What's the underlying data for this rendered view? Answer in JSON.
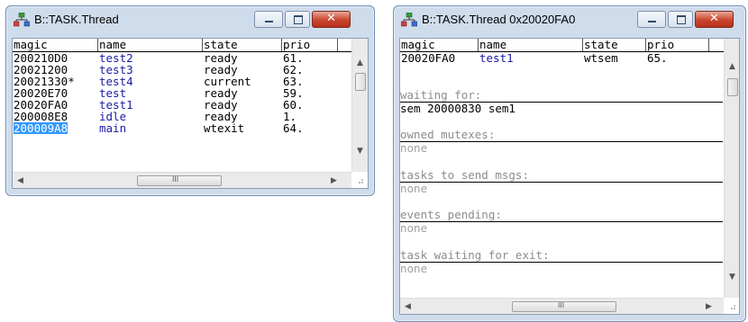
{
  "window1": {
    "title": "B::TASK.Thread",
    "columns": [
      "magic",
      "name",
      "state",
      "prio"
    ],
    "rows": [
      {
        "magic": "200210D0",
        "name": "test2",
        "state": "ready",
        "prio": "61."
      },
      {
        "magic": "20021200",
        "name": "test3",
        "state": "ready",
        "prio": "62."
      },
      {
        "magic": "20021330*",
        "name": "test4",
        "state": "current",
        "prio": "63."
      },
      {
        "magic": "20020E70",
        "name": "test",
        "state": "ready",
        "prio": "59."
      },
      {
        "magic": "20020FA0",
        "name": "test1",
        "state": "ready",
        "prio": "60."
      },
      {
        "magic": "200008E8",
        "name": "idle",
        "state": "ready",
        "prio": "1."
      },
      {
        "magic": "200009A8",
        "name": "main",
        "state": "wtexit",
        "prio": "64."
      }
    ],
    "selected_row": 6
  },
  "window2": {
    "title": "B::TASK.Thread 0x20020FA0",
    "columns": [
      "magic",
      "name",
      "state",
      "prio"
    ],
    "row": {
      "magic": "20020FA0",
      "name": "test1",
      "state": "wtsem",
      "prio": "65."
    },
    "sections": [
      {
        "title": "waiting for:",
        "value": "sem  20000830  sem1"
      },
      {
        "title": "owned mutexes:",
        "value": "none"
      },
      {
        "title": "tasks to send msgs:",
        "value": "none"
      },
      {
        "title": "events pending:",
        "value": "none"
      },
      {
        "title": "task waiting for exit:",
        "value": "none"
      }
    ]
  },
  "controls": {
    "minimize_glyph": "▁",
    "maximize_glyph": "□",
    "close_glyph": "✕",
    "scroll_up": "▲",
    "scroll_down": "▼",
    "scroll_left": "◀",
    "scroll_right": "▶",
    "thumb_grip": "III"
  },
  "colors": {
    "frame": "#cfdcec",
    "selection": "#3399ff",
    "task_name": "#1a1aa6",
    "section_title": "#8c8c8c",
    "close_button": "#c9452d"
  }
}
